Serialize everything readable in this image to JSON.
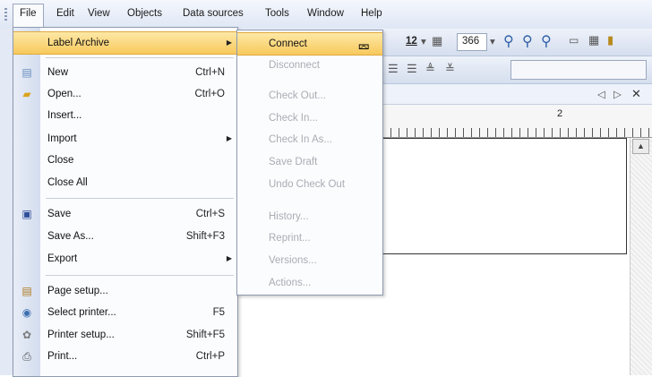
{
  "menubar": {
    "items": [
      "File",
      "Edit",
      "View",
      "Objects",
      "Data sources",
      "Tools",
      "Window",
      "Help"
    ]
  },
  "toolbar": {
    "font_size": "12",
    "zoom_value": "366",
    "icons": [
      "zoom-in-icon",
      "zoom-out-icon",
      "zoom-fit-icon",
      "window-icon",
      "grid-icon"
    ]
  },
  "ruler": {
    "marker": "2"
  },
  "file_menu": {
    "items": [
      {
        "label": "Label Archive",
        "shortcut": "",
        "submenu": true
      },
      {
        "label": "New",
        "shortcut": "Ctrl+N"
      },
      {
        "label": "Open...",
        "shortcut": "Ctrl+O"
      },
      {
        "label": "Insert...",
        "shortcut": ""
      },
      {
        "label": "Import",
        "shortcut": "",
        "submenu": true
      },
      {
        "label": "Close",
        "shortcut": ""
      },
      {
        "label": "Close All",
        "shortcut": ""
      },
      {
        "label": "Save",
        "shortcut": "Ctrl+S"
      },
      {
        "label": "Save As...",
        "shortcut": "Shift+F3"
      },
      {
        "label": "Export",
        "shortcut": "",
        "submenu": true
      },
      {
        "label": "Page setup...",
        "shortcut": ""
      },
      {
        "label": "Select printer...",
        "shortcut": "F5"
      },
      {
        "label": "Printer setup...",
        "shortcut": "Shift+F5"
      },
      {
        "label": "Print...",
        "shortcut": "Ctrl+P"
      }
    ]
  },
  "label_archive_menu": {
    "items": [
      {
        "label": "Connect",
        "enabled": true
      },
      {
        "label": "Disconnect",
        "enabled": false
      },
      {
        "label": "Check Out...",
        "enabled": false
      },
      {
        "label": "Check In...",
        "enabled": false
      },
      {
        "label": "Check In As...",
        "enabled": false
      },
      {
        "label": "Save Draft",
        "enabled": false
      },
      {
        "label": "Undo Check Out",
        "enabled": false
      },
      {
        "label": "History...",
        "enabled": false
      },
      {
        "label": "Reprint...",
        "enabled": false
      },
      {
        "label": "Versions...",
        "enabled": false
      },
      {
        "label": "Actions...",
        "enabled": false
      }
    ]
  },
  "colors": {
    "highlight": "#f8c95c",
    "disabled_text": "#a9acb3",
    "menubar_bg": "#dfe7f5"
  }
}
